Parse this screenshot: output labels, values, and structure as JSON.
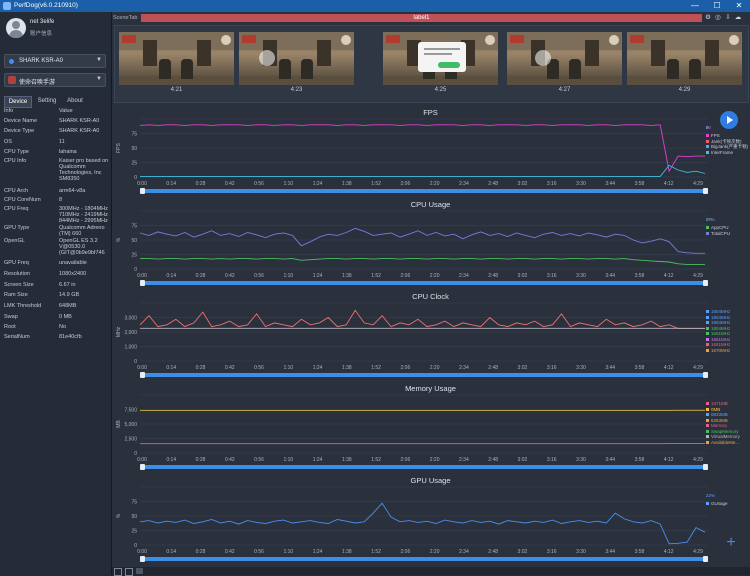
{
  "app": {
    "title": "PerfDog(v6.0.210910)"
  },
  "window_controls": {
    "minimize": "—",
    "maximize": "☐",
    "close": "✕"
  },
  "user": {
    "name": "net 3elife",
    "info_label": "账户信息"
  },
  "device_select": {
    "value": "SHARK KSR-A0"
  },
  "app_select": {
    "value": "使命召唤手游"
  },
  "tabs": [
    "Device",
    "Setting",
    "About"
  ],
  "active_tab": "Device",
  "info": {
    "header": {
      "key": "Info",
      "value": "Value"
    },
    "rows": [
      {
        "k": "Device Name",
        "v": "SHARK KSR-A0"
      },
      {
        "k": "Device Type",
        "v": "SHARK KSR-A0"
      },
      {
        "k": "OS",
        "v": "11"
      },
      {
        "k": "CPU Type",
        "v": "lahaina"
      },
      {
        "k": "CPU Info",
        "v": "Kaiser pro based on Qualcomm Technologies, Inc SM8350"
      },
      {
        "k": "CPU Arch",
        "v": "arm64-v8a"
      },
      {
        "k": "CPU CoreNum",
        "v": "8"
      },
      {
        "k": "CPU Freq",
        "v": "300MHz - 1804MHz 710MHz - 2419MHz 844MHz - 2995MHz"
      },
      {
        "k": "GPU Type",
        "v": "Qualcomm Adreno (TM) 660"
      },
      {
        "k": "OpenGL",
        "v": "OpenGL ES 3.2 V@0530.0 (GIT@0b9e9bf746"
      },
      {
        "k": "GPU Freq",
        "v": "unavailable"
      },
      {
        "k": "Resolution",
        "v": "1080x2400"
      },
      {
        "k": "Screen Size",
        "v": "6.67 in"
      },
      {
        "k": "Ram Size",
        "v": "14.9 GB"
      },
      {
        "k": "LMK Threshold",
        "v": "648MB"
      },
      {
        "k": "Swap",
        "v": "0 MB"
      },
      {
        "k": "Root",
        "v": "No"
      },
      {
        "k": "SerialNum",
        "v": "81e40cfb"
      }
    ]
  },
  "scene": {
    "tab_label": "SceneTab",
    "label": "label1"
  },
  "toolbar_icons": [
    "settings-icon",
    "target-icon",
    "download-icon",
    "cloud-icon"
  ],
  "thumbnails": {
    "times": [
      "4:21",
      "4:23",
      "4:25",
      "4:27",
      "4:29"
    ]
  },
  "x_ticks": [
    "0:00",
    "0:14",
    "0:28",
    "0:42",
    "0:56",
    "1:10",
    "1:24",
    "1:38",
    "1:52",
    "2:06",
    "2:20",
    "2:34",
    "2:48",
    "3:02",
    "3:16",
    "3:30",
    "3:44",
    "3:58",
    "4:12",
    "4:29"
  ],
  "colors": {
    "accent": "#3d8ee6",
    "label_bar": "#c05058",
    "bg": "#2a303c"
  },
  "chart_data": [
    {
      "type": "line",
      "title": "FPS",
      "ylabel": "FPS",
      "ylim": [
        0,
        100
      ],
      "yticks": [
        "0",
        "25",
        "50",
        "75"
      ],
      "legend": [
        {
          "name": "FPS",
          "color": "#e040d0",
          "value": "36"
        },
        {
          "name": "Jank(卡顿次数)",
          "color": "#f06060",
          "value": "0"
        },
        {
          "name": "BigJank(严重卡顿)",
          "color": "#5aa0ff",
          "value": "0"
        },
        {
          "name": "InterFrame",
          "color": "#40c0e0",
          "value": "0"
        }
      ],
      "series": [
        {
          "name": "FPS",
          "color": "#e040d0",
          "values": [
            89,
            90,
            89,
            90,
            90,
            89,
            90,
            90,
            89,
            90,
            90,
            90,
            89,
            90,
            90,
            89,
            90,
            90,
            89,
            90,
            90,
            90,
            89,
            90,
            90,
            89,
            90,
            90,
            90,
            89,
            90,
            90,
            89,
            90,
            90,
            90,
            89,
            90,
            90,
            89,
            90,
            90,
            90,
            89,
            90,
            90,
            89,
            90,
            90,
            90,
            89,
            90,
            90,
            89,
            90,
            90,
            90,
            89,
            90,
            10,
            36,
            35,
            36,
            36
          ]
        },
        {
          "name": "InterFrame",
          "color": "#40c0e0",
          "values": [
            1,
            1,
            1,
            1,
            1,
            1,
            1,
            1,
            1,
            1,
            1,
            1,
            1,
            1,
            1,
            1,
            1,
            1,
            1,
            1,
            1,
            1,
            1,
            1,
            1,
            1,
            1,
            1,
            1,
            1,
            1,
            1,
            1,
            1,
            1,
            1,
            1,
            1,
            1,
            1,
            1,
            1,
            1,
            1,
            1,
            1,
            1,
            1,
            1,
            1,
            1,
            1,
            1,
            1,
            1,
            1,
            1,
            1,
            1,
            20,
            12,
            8,
            10,
            6
          ]
        }
      ]
    },
    {
      "type": "line",
      "title": "CPU Usage",
      "ylabel": "%",
      "ylim": [
        0,
        100
      ],
      "yticks": [
        "0",
        "25",
        "50",
        "75"
      ],
      "legend": [
        {
          "name": "AppCPU",
          "color": "#4cc060",
          "value": "8%"
        },
        {
          "name": "TotalCPU",
          "color": "#7a7ae0",
          "value": "27%"
        }
      ],
      "series": [
        {
          "name": "TotalCPU",
          "color": "#7a7ae0",
          "values": [
            62,
            58,
            64,
            60,
            57,
            63,
            55,
            60,
            66,
            58,
            61,
            56,
            63,
            59,
            54,
            60,
            62,
            58,
            40,
            47,
            55,
            60,
            58,
            63,
            70,
            65,
            58,
            60,
            62,
            55,
            60,
            66,
            58,
            63,
            57,
            60,
            52,
            59,
            64,
            58,
            61,
            56,
            62,
            58,
            54,
            60,
            63,
            58,
            61,
            57,
            62,
            59,
            55,
            60,
            58,
            50,
            45,
            48,
            52,
            47,
            30,
            28,
            27,
            27
          ]
        },
        {
          "name": "AppCPU",
          "color": "#4cc060",
          "values": [
            18,
            18,
            17,
            18,
            18,
            17,
            18,
            18,
            17,
            18,
            17,
            18,
            18,
            17,
            18,
            18,
            17,
            18,
            15,
            16,
            17,
            18,
            18,
            17,
            18,
            18,
            17,
            18,
            18,
            17,
            18,
            18,
            17,
            18,
            18,
            17,
            18,
            18,
            17,
            18,
            18,
            17,
            18,
            18,
            17,
            18,
            18,
            17,
            18,
            18,
            17,
            18,
            18,
            17,
            18,
            16,
            15,
            14,
            13,
            12,
            9,
            8,
            8,
            8
          ]
        }
      ]
    },
    {
      "type": "line",
      "title": "CPU Clock",
      "ylabel": "MHz",
      "ylim": [
        0,
        3200
      ],
      "yticks": [
        "0",
        "1,000",
        "2,000",
        "3,000"
      ],
      "legend": [
        {
          "name": "1804MHz",
          "color": "#5aa0ff",
          "value": ""
        },
        {
          "name": "1804MHz",
          "color": "#5aa0ff",
          "value": ""
        },
        {
          "name": "1804MHz",
          "color": "#5aa0ff",
          "value": ""
        },
        {
          "name": "1804MHz",
          "color": "#4cc060",
          "value": ""
        },
        {
          "name": "1651MHz",
          "color": "#4cc060",
          "value": ""
        },
        {
          "name": "1651MHz",
          "color": "#c07ae0",
          "value": ""
        },
        {
          "name": "1651MHz",
          "color": "#f06060",
          "value": ""
        },
        {
          "name": "1670MHz",
          "color": "#f0a040",
          "value": ""
        }
      ],
      "series": [
        {
          "name": "Big",
          "color": "#f07070",
          "values": [
            2000,
            2500,
            1900,
            2000,
            2300,
            1900,
            2100,
            2700,
            1900,
            2000,
            2200,
            1900,
            2000,
            2600,
            1900,
            2100,
            2000,
            1900,
            2300,
            2000,
            2100,
            2400,
            1900,
            2000,
            2800,
            2100,
            2000,
            2500,
            1900,
            2100,
            2000,
            2300,
            1900,
            2000,
            2200,
            1900,
            2100,
            2000,
            1900,
            2400,
            2000,
            1900,
            2100,
            2000,
            2200,
            1900,
            2000,
            2600,
            1900,
            2100,
            2000,
            1900,
            2300,
            2000,
            2100,
            1900,
            2000,
            2200,
            1900,
            2000,
            1800,
            1800,
            1800,
            1800
          ]
        },
        {
          "name": "Little",
          "color": "#b0b6c4",
          "values": [
            1804,
            1804,
            1804,
            1804,
            1804,
            1804,
            1804,
            1804,
            1804,
            1804,
            1804,
            1804,
            1804,
            1804,
            1804,
            1804,
            1804,
            1804,
            1804,
            1804,
            1804,
            1804,
            1804,
            1804,
            1804,
            1804,
            1804,
            1804,
            1804,
            1804,
            1804,
            1804,
            1804,
            1804,
            1804,
            1804,
            1804,
            1804,
            1804,
            1804,
            1804,
            1804,
            1804,
            1804,
            1804,
            1804,
            1804,
            1804,
            1804,
            1804,
            1804,
            1804,
            1804,
            1804,
            1804,
            1804,
            1804,
            1804,
            1804,
            1804,
            1804,
            1804,
            1804,
            1804
          ]
        }
      ]
    },
    {
      "type": "line",
      "title": "Memory Usage",
      "ylabel": "MB",
      "ylim": [
        0,
        8500
      ],
      "yticks": [
        "0",
        "2,500",
        "5,000",
        "7,500"
      ],
      "legend": [
        {
          "name": "1371MB",
          "color": "#e06090",
          "value": ""
        },
        {
          "name": "0MB",
          "color": "#f0c040",
          "value": ""
        },
        {
          "name": "8833MB",
          "color": "#5aa0ff",
          "value": ""
        },
        {
          "name": "6263MB",
          "color": "#f0a040",
          "value": ""
        },
        {
          "name": "Memory",
          "color": "#e06090",
          "value": ""
        },
        {
          "name": "SwapMemory",
          "color": "#4cc060",
          "value": ""
        },
        {
          "name": "VirtualMemory",
          "color": "#b0b6c4",
          "value": ""
        },
        {
          "name": "AvailableMe...",
          "color": "#f0a040",
          "value": ""
        }
      ],
      "series": [
        {
          "name": "AvailableMemory",
          "color": "#d0b040",
          "values": [
            6250,
            6250,
            6250,
            6250,
            6250,
            6250,
            6250,
            6250,
            6250,
            6250,
            6250,
            6250,
            6250,
            6250,
            6250,
            6250,
            6250,
            6250,
            6250,
            6250,
            6250,
            6250,
            6250,
            6250,
            6250,
            6250,
            6250,
            6250,
            6250,
            6250,
            6250,
            6250,
            6250,
            6250,
            6250,
            6250,
            6250,
            6250,
            6250,
            6250,
            6250,
            6250,
            6250,
            6250,
            6250,
            6250,
            6250,
            6250,
            6250,
            6250,
            6250,
            6250,
            6250,
            6250,
            6250,
            6250,
            6250,
            6250,
            6250,
            6250,
            6260,
            6263,
            6263,
            6263
          ]
        },
        {
          "name": "Memory",
          "color": "#e06090",
          "values": [
            1370,
            1370,
            1370,
            1370,
            1370,
            1370,
            1370,
            1370,
            1370,
            1370,
            1370,
            1370,
            1370,
            1370,
            1370,
            1370,
            1370,
            1370,
            1370,
            1370,
            1370,
            1370,
            1370,
            1370,
            1370,
            1370,
            1370,
            1370,
            1370,
            1370,
            1370,
            1370,
            1370,
            1370,
            1370,
            1370,
            1370,
            1370,
            1370,
            1370,
            1370,
            1370,
            1370,
            1370,
            1370,
            1370,
            1370,
            1370,
            1370,
            1370,
            1370,
            1370,
            1370,
            1370,
            1370,
            1370,
            1370,
            1370,
            1370,
            1371,
            1371,
            1371,
            1371,
            1371
          ]
        }
      ]
    },
    {
      "type": "line",
      "title": "GPU Usage",
      "ylabel": "%",
      "ylim": [
        0,
        100
      ],
      "yticks": [
        "0",
        "25",
        "50",
        "75"
      ],
      "legend": [
        {
          "name": "GUsage",
          "color": "#5aa0ff",
          "value": "22%"
        }
      ],
      "series": [
        {
          "name": "GUsage",
          "color": "#4a8ff0",
          "values": [
            40,
            42,
            38,
            41,
            39,
            43,
            37,
            40,
            44,
            38,
            41,
            36,
            42,
            39,
            37,
            41,
            43,
            38,
            40,
            42,
            39,
            37,
            44,
            41,
            38,
            40,
            55,
            72,
            48,
            40,
            42,
            39,
            41,
            37,
            43,
            40,
            38,
            42,
            39,
            41,
            36,
            42,
            40,
            38,
            41,
            39,
            43,
            37,
            40,
            42,
            39,
            41,
            38,
            55,
            45,
            40,
            38,
            42,
            36,
            2,
            3,
            5,
            30,
            22
          ]
        }
      ]
    }
  ]
}
